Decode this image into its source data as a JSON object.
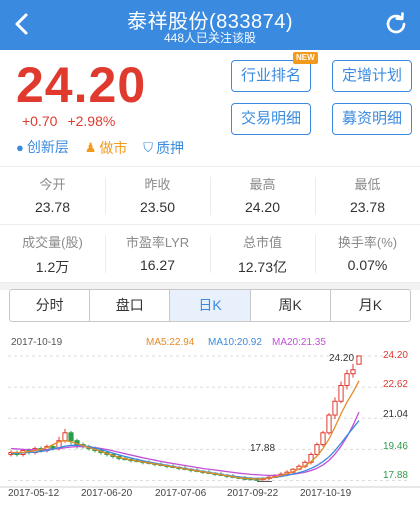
{
  "header": {
    "title": "泰祥股份(833874)",
    "subtitle": "448人已关注该股"
  },
  "quote": {
    "price": "24.20",
    "change": "+0.70",
    "change_pct": "+2.98%",
    "tags": [
      "创新层",
      "做市",
      "质押"
    ],
    "buttons": [
      "行业排名",
      "定增计划",
      "交易明细",
      "募资明细"
    ],
    "new_badge": "NEW"
  },
  "stats": {
    "row1": [
      {
        "label": "今开",
        "value": "23.78"
      },
      {
        "label": "昨收",
        "value": "23.50"
      },
      {
        "label": "最高",
        "value": "24.20"
      },
      {
        "label": "最低",
        "value": "23.78"
      }
    ],
    "row2": [
      {
        "label": "成交量(股)",
        "value": "1.2万"
      },
      {
        "label": "市盈率LYR",
        "value": "16.27"
      },
      {
        "label": "总市值",
        "value": "12.73亿"
      },
      {
        "label": "换手率(%)",
        "value": "0.07%"
      }
    ]
  },
  "tabs": [
    {
      "label": "分时",
      "active": false
    },
    {
      "label": "盘口",
      "active": false
    },
    {
      "label": "日K",
      "active": true
    },
    {
      "label": "周K",
      "active": false
    },
    {
      "label": "月K",
      "active": false
    }
  ],
  "colors": {
    "brand": "#3a8be0",
    "up": "#e03a2f",
    "down": "#2a9d4a",
    "ma5": "#e58a2a",
    "ma10": "#3a8be0",
    "ma20": "#c24fd6"
  },
  "chart_data": {
    "type": "candlestick",
    "date_label": "2017-10-19",
    "ma_labels": {
      "ma5": "MA5:22.94",
      "ma10": "MA10:20.92",
      "ma20": "MA20:21.35"
    },
    "y_ticks": [
      "24.20",
      "22.62",
      "21.04",
      "19.46",
      "17.88"
    ],
    "x_ticks": [
      "2017-05-12",
      "2017-06-20",
      "2017-07-06",
      "2017-09-22",
      "2017-10-19"
    ],
    "high_label": "24.20",
    "low_label": "17.88",
    "ylim": [
      17.6,
      24.4
    ],
    "candles": [
      {
        "o": 19.2,
        "c": 19.3,
        "h": 19.4,
        "l": 19.1
      },
      {
        "o": 19.3,
        "c": 19.2,
        "h": 19.4,
        "l": 19.1
      },
      {
        "o": 19.2,
        "c": 19.4,
        "h": 19.5,
        "l": 19.1
      },
      {
        "o": 19.4,
        "c": 19.3,
        "h": 19.5,
        "l": 19.2
      },
      {
        "o": 19.3,
        "c": 19.5,
        "h": 19.6,
        "l": 19.2
      },
      {
        "o": 19.5,
        "c": 19.4,
        "h": 19.6,
        "l": 19.3
      },
      {
        "o": 19.4,
        "c": 19.6,
        "h": 19.7,
        "l": 19.3
      },
      {
        "o": 19.6,
        "c": 19.5,
        "h": 19.7,
        "l": 19.4
      },
      {
        "o": 19.5,
        "c": 19.9,
        "h": 20.1,
        "l": 19.4
      },
      {
        "o": 19.9,
        "c": 20.3,
        "h": 20.5,
        "l": 19.8
      },
      {
        "o": 20.3,
        "c": 19.9,
        "h": 20.4,
        "l": 19.7
      },
      {
        "o": 19.9,
        "c": 19.7,
        "h": 20.0,
        "l": 19.5
      },
      {
        "o": 19.7,
        "c": 19.6,
        "h": 19.8,
        "l": 19.5
      },
      {
        "o": 19.6,
        "c": 19.5,
        "h": 19.7,
        "l": 19.4
      },
      {
        "o": 19.5,
        "c": 19.4,
        "h": 19.6,
        "l": 19.3
      },
      {
        "o": 19.4,
        "c": 19.3,
        "h": 19.5,
        "l": 19.2
      },
      {
        "o": 19.3,
        "c": 19.2,
        "h": 19.4,
        "l": 19.1
      },
      {
        "o": 19.2,
        "c": 19.1,
        "h": 19.3,
        "l": 19.0
      },
      {
        "o": 19.1,
        "c": 19.0,
        "h": 19.2,
        "l": 18.9
      },
      {
        "o": 19.0,
        "c": 18.95,
        "h": 19.1,
        "l": 18.9
      },
      {
        "o": 18.95,
        "c": 18.9,
        "h": 19.0,
        "l": 18.8
      },
      {
        "o": 18.9,
        "c": 18.85,
        "h": 19.0,
        "l": 18.8
      },
      {
        "o": 18.85,
        "c": 18.8,
        "h": 18.9,
        "l": 18.7
      },
      {
        "o": 18.8,
        "c": 18.75,
        "h": 18.9,
        "l": 18.7
      },
      {
        "o": 18.75,
        "c": 18.7,
        "h": 18.8,
        "l": 18.6
      },
      {
        "o": 18.7,
        "c": 18.65,
        "h": 18.8,
        "l": 18.6
      },
      {
        "o": 18.65,
        "c": 18.6,
        "h": 18.7,
        "l": 18.5
      },
      {
        "o": 18.6,
        "c": 18.55,
        "h": 18.7,
        "l": 18.5
      },
      {
        "o": 18.55,
        "c": 18.5,
        "h": 18.6,
        "l": 18.4
      },
      {
        "o": 18.5,
        "c": 18.45,
        "h": 18.6,
        "l": 18.4
      },
      {
        "o": 18.45,
        "c": 18.4,
        "h": 18.5,
        "l": 18.3
      },
      {
        "o": 18.4,
        "c": 18.35,
        "h": 18.5,
        "l": 18.3
      },
      {
        "o": 18.35,
        "c": 18.3,
        "h": 18.4,
        "l": 18.2
      },
      {
        "o": 18.3,
        "c": 18.25,
        "h": 18.4,
        "l": 18.2
      },
      {
        "o": 18.25,
        "c": 18.2,
        "h": 18.3,
        "l": 18.1
      },
      {
        "o": 18.2,
        "c": 18.15,
        "h": 18.3,
        "l": 18.1
      },
      {
        "o": 18.15,
        "c": 18.1,
        "h": 18.2,
        "l": 18.0
      },
      {
        "o": 18.1,
        "c": 18.05,
        "h": 18.2,
        "l": 18.0
      },
      {
        "o": 18.05,
        "c": 18.0,
        "h": 18.1,
        "l": 17.95
      },
      {
        "o": 18.0,
        "c": 17.98,
        "h": 18.1,
        "l": 17.9
      },
      {
        "o": 17.98,
        "c": 17.95,
        "h": 18.05,
        "l": 17.9
      },
      {
        "o": 17.95,
        "c": 17.93,
        "h": 18.0,
        "l": 17.88
      },
      {
        "o": 17.93,
        "c": 17.98,
        "h": 18.05,
        "l": 17.88
      },
      {
        "o": 17.98,
        "c": 18.05,
        "h": 18.1,
        "l": 17.9
      },
      {
        "o": 18.05,
        "c": 18.1,
        "h": 18.2,
        "l": 18.0
      },
      {
        "o": 18.1,
        "c": 18.2,
        "h": 18.3,
        "l": 18.05
      },
      {
        "o": 18.2,
        "c": 18.3,
        "h": 18.4,
        "l": 18.1
      },
      {
        "o": 18.3,
        "c": 18.45,
        "h": 18.5,
        "l": 18.2
      },
      {
        "o": 18.45,
        "c": 18.6,
        "h": 18.7,
        "l": 18.4
      },
      {
        "o": 18.6,
        "c": 18.8,
        "h": 18.9,
        "l": 18.5
      },
      {
        "o": 18.8,
        "c": 19.2,
        "h": 19.3,
        "l": 18.7
      },
      {
        "o": 19.2,
        "c": 19.7,
        "h": 19.8,
        "l": 19.1
      },
      {
        "o": 19.7,
        "c": 20.3,
        "h": 20.4,
        "l": 19.6
      },
      {
        "o": 20.3,
        "c": 21.2,
        "h": 21.3,
        "l": 20.2
      },
      {
        "o": 21.2,
        "c": 21.9,
        "h": 22.1,
        "l": 21.0
      },
      {
        "o": 21.9,
        "c": 22.7,
        "h": 22.9,
        "l": 21.8
      },
      {
        "o": 22.7,
        "c": 23.3,
        "h": 23.5,
        "l": 22.5
      },
      {
        "o": 23.3,
        "c": 23.5,
        "h": 23.8,
        "l": 23.1
      },
      {
        "o": 23.78,
        "c": 24.2,
        "h": 24.2,
        "l": 23.78
      }
    ],
    "ma5": [
      19.3,
      19.3,
      19.3,
      19.35,
      19.4,
      19.45,
      19.55,
      19.7,
      19.85,
      19.9,
      19.85,
      19.75,
      19.65,
      19.55,
      19.45,
      19.35,
      19.25,
      19.15,
      19.05,
      18.98,
      18.92,
      18.87,
      18.82,
      18.77,
      18.72,
      18.67,
      18.62,
      18.57,
      18.52,
      18.47,
      18.42,
      18.37,
      18.32,
      18.27,
      18.22,
      18.17,
      18.12,
      18.07,
      18.02,
      17.99,
      17.97,
      17.96,
      17.97,
      18.0,
      18.06,
      18.13,
      18.22,
      18.33,
      18.46,
      18.62,
      18.84,
      19.12,
      19.5,
      19.98,
      20.6,
      21.26,
      21.86,
      22.36,
      22.94
    ],
    "ma10": [
      19.25,
      19.26,
      19.28,
      19.3,
      19.32,
      19.35,
      19.4,
      19.47,
      19.55,
      19.62,
      19.66,
      19.67,
      19.65,
      19.6,
      19.53,
      19.45,
      19.36,
      19.27,
      19.18,
      19.1,
      19.02,
      18.95,
      18.88,
      18.82,
      18.76,
      18.7,
      18.65,
      18.59,
      18.54,
      18.49,
      18.44,
      18.39,
      18.34,
      18.29,
      18.24,
      18.19,
      18.14,
      18.1,
      18.06,
      18.03,
      18.0,
      17.99,
      17.99,
      18.01,
      18.04,
      18.08,
      18.14,
      18.2,
      18.28,
      18.37,
      18.49,
      18.64,
      18.84,
      19.08,
      19.4,
      19.77,
      20.16,
      20.54,
      20.92
    ],
    "ma20": [
      19.5,
      19.48,
      19.46,
      19.45,
      19.44,
      19.44,
      19.45,
      19.47,
      19.5,
      19.54,
      19.58,
      19.6,
      19.6,
      19.58,
      19.55,
      19.5,
      19.45,
      19.38,
      19.31,
      19.24,
      19.17,
      19.1,
      19.03,
      18.97,
      18.91,
      18.85,
      18.79,
      18.74,
      18.69,
      18.64,
      18.59,
      18.54,
      18.49,
      18.45,
      18.41,
      18.37,
      18.33,
      18.29,
      18.25,
      18.22,
      18.19,
      18.17,
      18.15,
      18.14,
      18.14,
      18.15,
      18.17,
      18.2,
      18.24,
      18.3,
      18.38,
      18.5,
      18.67,
      18.9,
      19.22,
      19.62,
      20.1,
      20.68,
      21.35
    ],
    "volume_hint": "low-volume bars near baseline"
  }
}
